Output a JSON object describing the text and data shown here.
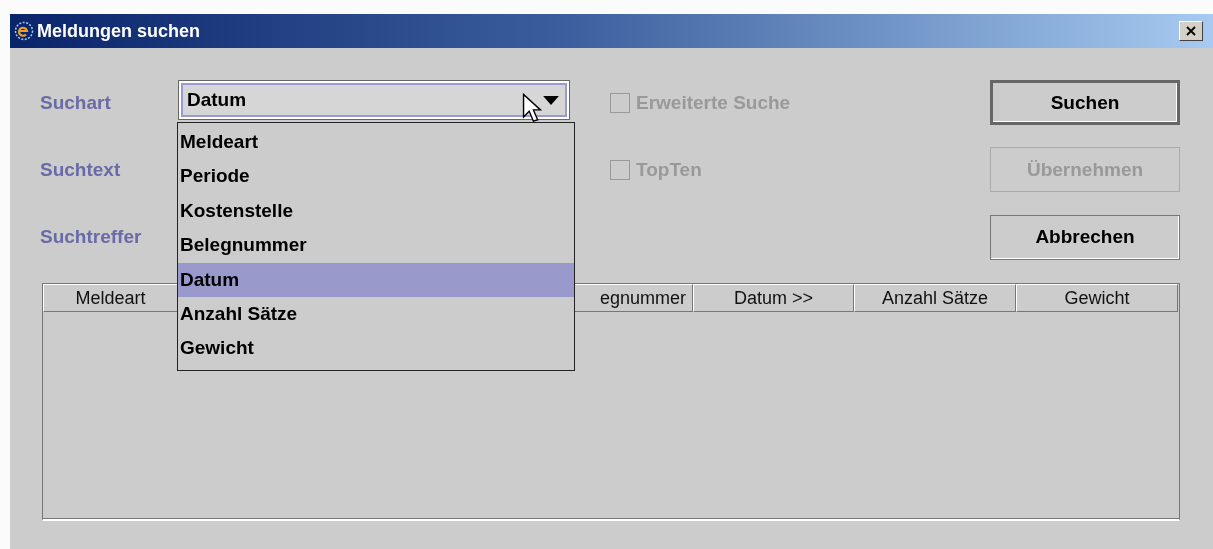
{
  "window": {
    "title": "Meldungen suchen"
  },
  "form": {
    "labels": [
      "Suchart",
      "Suchtext",
      "Suchtreffer"
    ],
    "search_type": {
      "value": "Datum",
      "expanded": true,
      "options": [
        {
          "label": "Meldeart",
          "selected": false
        },
        {
          "label": "Periode",
          "selected": false
        },
        {
          "label": "Kostenstelle",
          "selected": false
        },
        {
          "label": "Belegnummer",
          "selected": false
        },
        {
          "label": "Datum",
          "selected": true
        },
        {
          "label": "Anzahl Sätze",
          "selected": false
        },
        {
          "label": "Gewicht",
          "selected": false
        }
      ]
    },
    "checkboxes": [
      {
        "label": "Erweiterte Suche",
        "checked": false,
        "disabled": true
      },
      {
        "label": "TopTen",
        "checked": false,
        "disabled": true
      }
    ],
    "buttons": [
      {
        "label": "Suchen",
        "default": true,
        "disabled": false
      },
      {
        "label": "Übernehmen",
        "default": false,
        "disabled": true
      },
      {
        "label": "Abbrechen",
        "default": false,
        "disabled": false
      }
    ]
  },
  "table": {
    "columns": [
      "Meldeart",
      "egnummer",
      "Datum >>",
      "Anzahl Sätze",
      "Gewicht"
    ]
  }
}
